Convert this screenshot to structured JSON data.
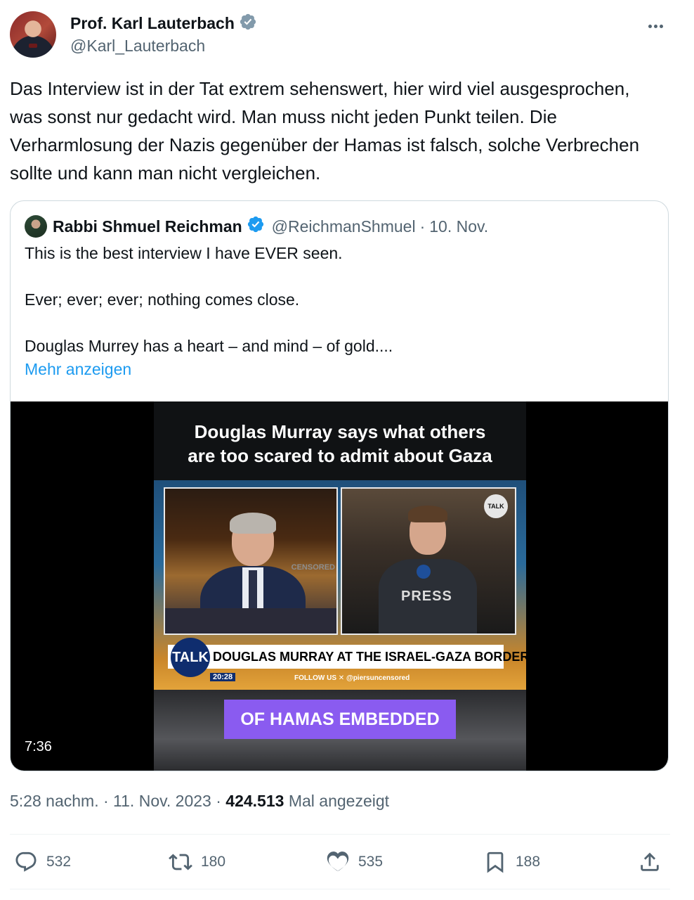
{
  "author": {
    "name": "Prof. Karl Lauterbach",
    "handle": "@Karl_Lauterbach",
    "verified_color": "#829aab"
  },
  "tweet": {
    "text": "Das Interview ist in der Tat extrem sehenswert, hier wird viel ausgesprochen, was sonst nur gedacht wird. Man muss nicht jeden Punkt teilen. Die Verharmlosung der Nazis gegenüber der Hamas ist falsch, solche Verbrechen sollte und kann man nicht vergleichen."
  },
  "quote": {
    "name": "Rabbi Shmuel Reichman",
    "handle": "@ReichmanShmuel",
    "separator": "·",
    "date": "10. Nov.",
    "verified_color": "#1d9bf0",
    "lines": [
      "This is the best interview I have EVER seen.",
      "Ever; ever; ever; nothing comes close.",
      "Douglas Murrey has a heart – and mind – of gold...."
    ],
    "show_more": "Mehr anzeigen",
    "video": {
      "title_line1": "Douglas Murray says what others",
      "title_line2": "are too scared to admit about Gaza",
      "lower_third": "DOUGLAS MURRAY AT THE ISRAEL-GAZA BORDER",
      "channel_badge": "TALK",
      "clock": "20:28",
      "follow": "FOLLOW US",
      "follow_handle": "@piersuncensored",
      "press": "PRESS",
      "censored": "CENSORED",
      "logo": "TALK",
      "caption": "OF HAMAS EMBEDDED",
      "duration": "7:36"
    }
  },
  "meta": {
    "time": "5:28 nachm.",
    "sep1": " · ",
    "date": "11. Nov. 2023",
    "sep2": " · ",
    "views": "424.513",
    "views_label": " Mal angezeigt"
  },
  "actions": {
    "replies": "532",
    "reposts": "180",
    "likes": "535",
    "bookmarks": "188"
  },
  "colors": {
    "text": "#0f1419",
    "secondary": "#536471",
    "link": "#1d9bf0",
    "border": "#cfd9de",
    "caption_bg": "#8a5bf0"
  }
}
